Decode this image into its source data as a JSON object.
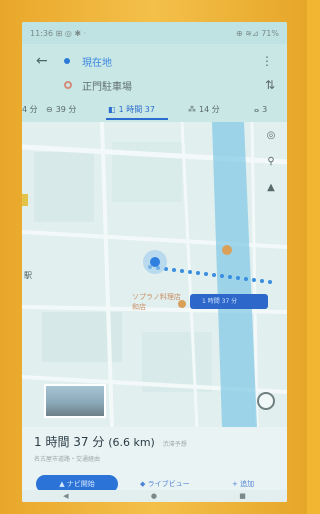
{
  "status_bar": {
    "time_and_icons": "11:36 ⊞ ◎ ✱  ·",
    "right": "⊕ ≋⊿ 71%"
  },
  "route": {
    "origin": "現在地",
    "destination": "正門駐車場"
  },
  "modes": [
    {
      "icon": "car-icon",
      "label": "39 分"
    },
    {
      "icon": "transit-icon",
      "label": "1 時間 37"
    },
    {
      "icon": "walk-icon",
      "label": "14 分"
    },
    {
      "icon": "bike-icon",
      "label": "3"
    }
  ],
  "map": {
    "station_label": "駅",
    "place_label_1": "ソプラノ料理店",
    "place_label_2": "和店",
    "route_chip": "1 時間 37 分"
  },
  "summary": {
    "duration": "1 時間 37 分",
    "distance": "(6.6 km)",
    "note": "渋滞予想",
    "via": "名古屋市道路・交通経由"
  },
  "actions": {
    "navigate": "ナビ開始",
    "live_view": "ライブビュー",
    "more": "追加"
  },
  "nav_bar": [
    "◀",
    "●",
    "■"
  ],
  "colors": {
    "accent": "#2b73d6",
    "frame": "#f2b632"
  }
}
